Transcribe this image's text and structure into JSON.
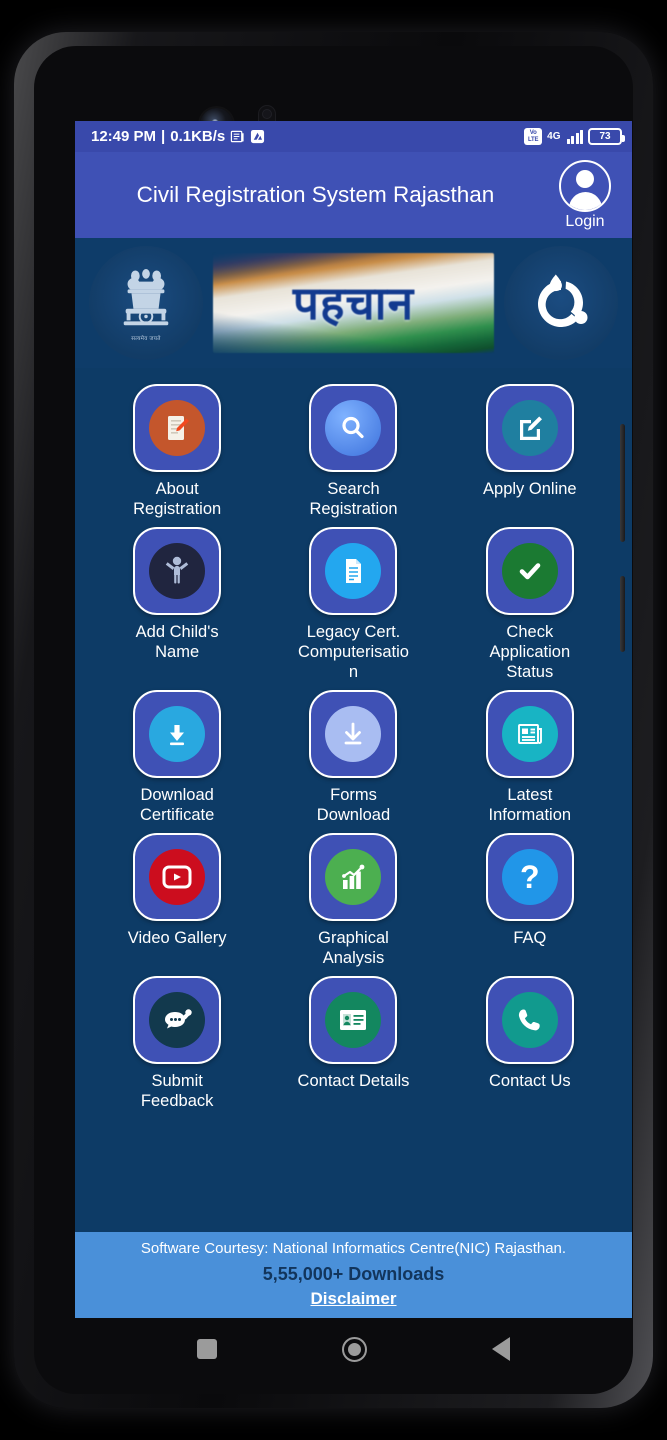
{
  "status_bar": {
    "time": "12:49 PM",
    "separator": "|",
    "network_speed": "0.1KB/s",
    "notification_icons": [
      "news-icon",
      "app-update-icon"
    ],
    "volte_top": "Vo",
    "volte_bottom": "LTE",
    "network_type": "4G",
    "battery_level": "73"
  },
  "app_bar": {
    "title": "Civil Registration System Rajasthan",
    "login_label": "Login"
  },
  "banner": {
    "emblem_name": "ashoka-pillar-emblem",
    "emblem_motto": "सत्यमेव जयते",
    "pehchan_text": "पहचान",
    "nic_logo_name": "nic-logo"
  },
  "menu": {
    "items": [
      {
        "label": "About Registration",
        "icon": "document-pen-icon",
        "circle_color": "#c4562c"
      },
      {
        "label": "Search Registration",
        "icon": "magnifier-icon",
        "circle_color": "#4a7fe8"
      },
      {
        "label": "Apply Online",
        "icon": "edit-square-icon",
        "circle_color": "#1f7fa0"
      },
      {
        "label": "Add Child's Name",
        "icon": "child-figure-icon",
        "circle_color": "#20253f"
      },
      {
        "label": "Legacy Cert. Computerisation",
        "icon": "document-lines-icon",
        "circle_color": "#23a7ef"
      },
      {
        "label": "Check Application Status",
        "icon": "check-circle-icon",
        "circle_color": "#1b7a32"
      },
      {
        "label": "Download Certificate",
        "icon": "download-arrow-icon",
        "circle_color": "#29a8e0"
      },
      {
        "label": "Forms Download",
        "icon": "download-forms-icon",
        "circle_color": "#a9bdf2"
      },
      {
        "label": "Latest Information",
        "icon": "newspaper-icon",
        "circle_color": "#18b4c4"
      },
      {
        "label": "Video Gallery",
        "icon": "video-play-icon",
        "circle_color": "#cc0d1e"
      },
      {
        "label": "Graphical Analysis",
        "icon": "bar-chart-icon",
        "circle_color": "#4caf50"
      },
      {
        "label": "FAQ",
        "icon": "question-mark-icon",
        "circle_color": "#2196e8"
      },
      {
        "label": "Submit Feedback",
        "icon": "feedback-chat-icon",
        "circle_color": "#12394d"
      },
      {
        "label": "Contact Details",
        "icon": "id-card-icon",
        "circle_color": "#13875f"
      },
      {
        "label": "Contact Us",
        "icon": "phone-icon",
        "circle_color": "#119a8e"
      }
    ]
  },
  "footer": {
    "courtesy": "Software Courtesy: National Informatics Centre(NIC) Rajasthan.",
    "downloads": "5,55,000+ Downloads",
    "disclaimer": "Disclaimer"
  },
  "nav_bar": {
    "recents": "recents-button",
    "home": "home-button",
    "back": "back-button"
  },
  "colors": {
    "status_bar": "#3949ab",
    "app_bar": "#3f51b5",
    "screen_bg": "#0d3b66",
    "tile_bg": "#3f51b5",
    "footer_bg": "#4a90d9"
  }
}
